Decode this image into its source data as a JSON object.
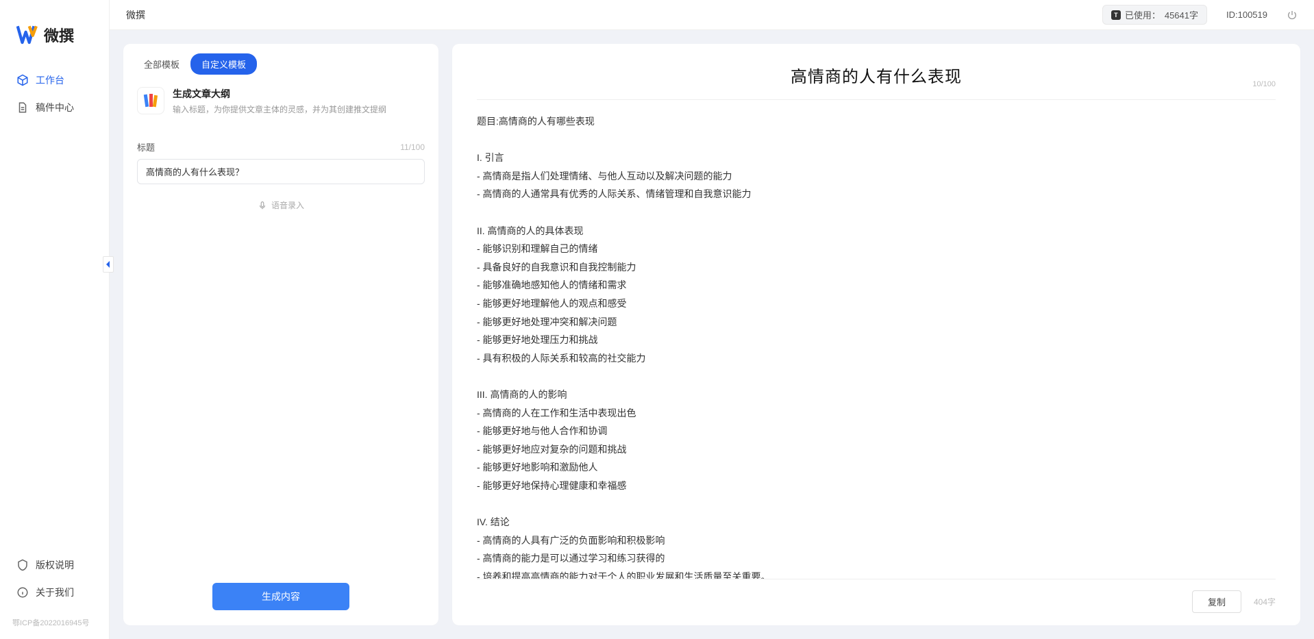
{
  "app": {
    "logoText": "微撰"
  },
  "sidebar": {
    "nav": [
      {
        "label": "工作台",
        "active": true
      },
      {
        "label": "稿件中心",
        "active": false
      }
    ],
    "bottom": [
      {
        "label": "版权说明"
      },
      {
        "label": "关于我们"
      }
    ],
    "icp": "鄂ICP备2022016945号"
  },
  "topbar": {
    "title": "微撰",
    "usagePrefix": "已使用：",
    "usageValue": "45641字",
    "idLabel": "ID:100519"
  },
  "left": {
    "tabs": [
      "全部模板",
      "自定义模板"
    ],
    "tool": {
      "title": "生成文章大纲",
      "desc": "输入标题，为你提供文章主体的灵感，并为其创建推文提纲"
    },
    "titleLabel": "标题",
    "titleCounter": "11/100",
    "titleValue": "高情商的人有什么表现？",
    "voiceHint": "语音录入",
    "generate": "生成内容"
  },
  "output": {
    "title": "高情商的人有什么表现",
    "headCounter": "10/100",
    "body": "题目:高情商的人有哪些表现\n\nI. 引言\n- 高情商是指人们处理情绪、与他人互动以及解决问题的能力\n- 高情商的人通常具有优秀的人际关系、情绪管理和自我意识能力\n\nII. 高情商的人的具体表现\n- 能够识别和理解自己的情绪\n- 具备良好的自我意识和自我控制能力\n- 能够准确地感知他人的情绪和需求\n- 能够更好地理解他人的观点和感受\n- 能够更好地处理冲突和解决问题\n- 能够更好地处理压力和挑战\n- 具有积极的人际关系和较高的社交能力\n\nIII. 高情商的人的影响\n- 高情商的人在工作和生活中表现出色\n- 能够更好地与他人合作和协调\n- 能够更好地应对复杂的问题和挑战\n- 能够更好地影响和激励他人\n- 能够更好地保持心理健康和幸福感\n\nIV. 结论\n- 高情商的人具有广泛的负面影响和积极影响\n- 高情商的能力是可以通过学习和练习获得的\n- 培养和提高高情商的能力对于个人的职业发展和生活质量至关重要。",
    "copy": "复制",
    "charCount": "404字"
  }
}
